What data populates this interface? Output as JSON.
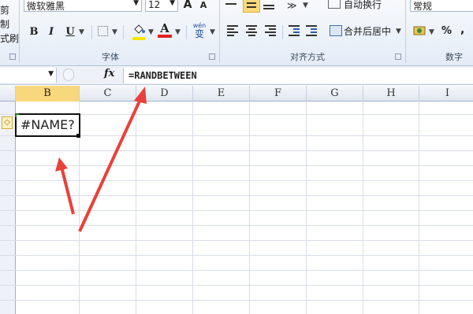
{
  "ribbon": {
    "clip_left_top": "剪",
    "clip_left_mid": "制",
    "clip_left_bot": "式刷",
    "font_name": "微软雅黑",
    "font_size": "12",
    "wen_label": "wén",
    "wen_char": "变",
    "font_group": "字体",
    "wrap_text": "自动换行",
    "merge_center": "合并后居中",
    "align_group": "对齐方式",
    "number_format": "常规",
    "percent": "%",
    "comma": ",",
    "number_group": "数字",
    "bold": "B",
    "italic": "I",
    "underline": "U",
    "grow_font": "A",
    "shrink_font": "A",
    "font_color_letter": "A"
  },
  "formula_bar": {
    "fx": "fx",
    "formula": "=RANDBETWEEN"
  },
  "columns": [
    "B",
    "C",
    "D",
    "E",
    "F",
    "G",
    "H",
    "I"
  ],
  "selected_column": "B",
  "active_cell": {
    "value": "#NAME?"
  },
  "colors": {
    "accent_arrow": "#e8413a",
    "selected_header": "#f9d77c",
    "font_color_bar": "#e02020",
    "fill_color_bar": "#f5e600"
  }
}
